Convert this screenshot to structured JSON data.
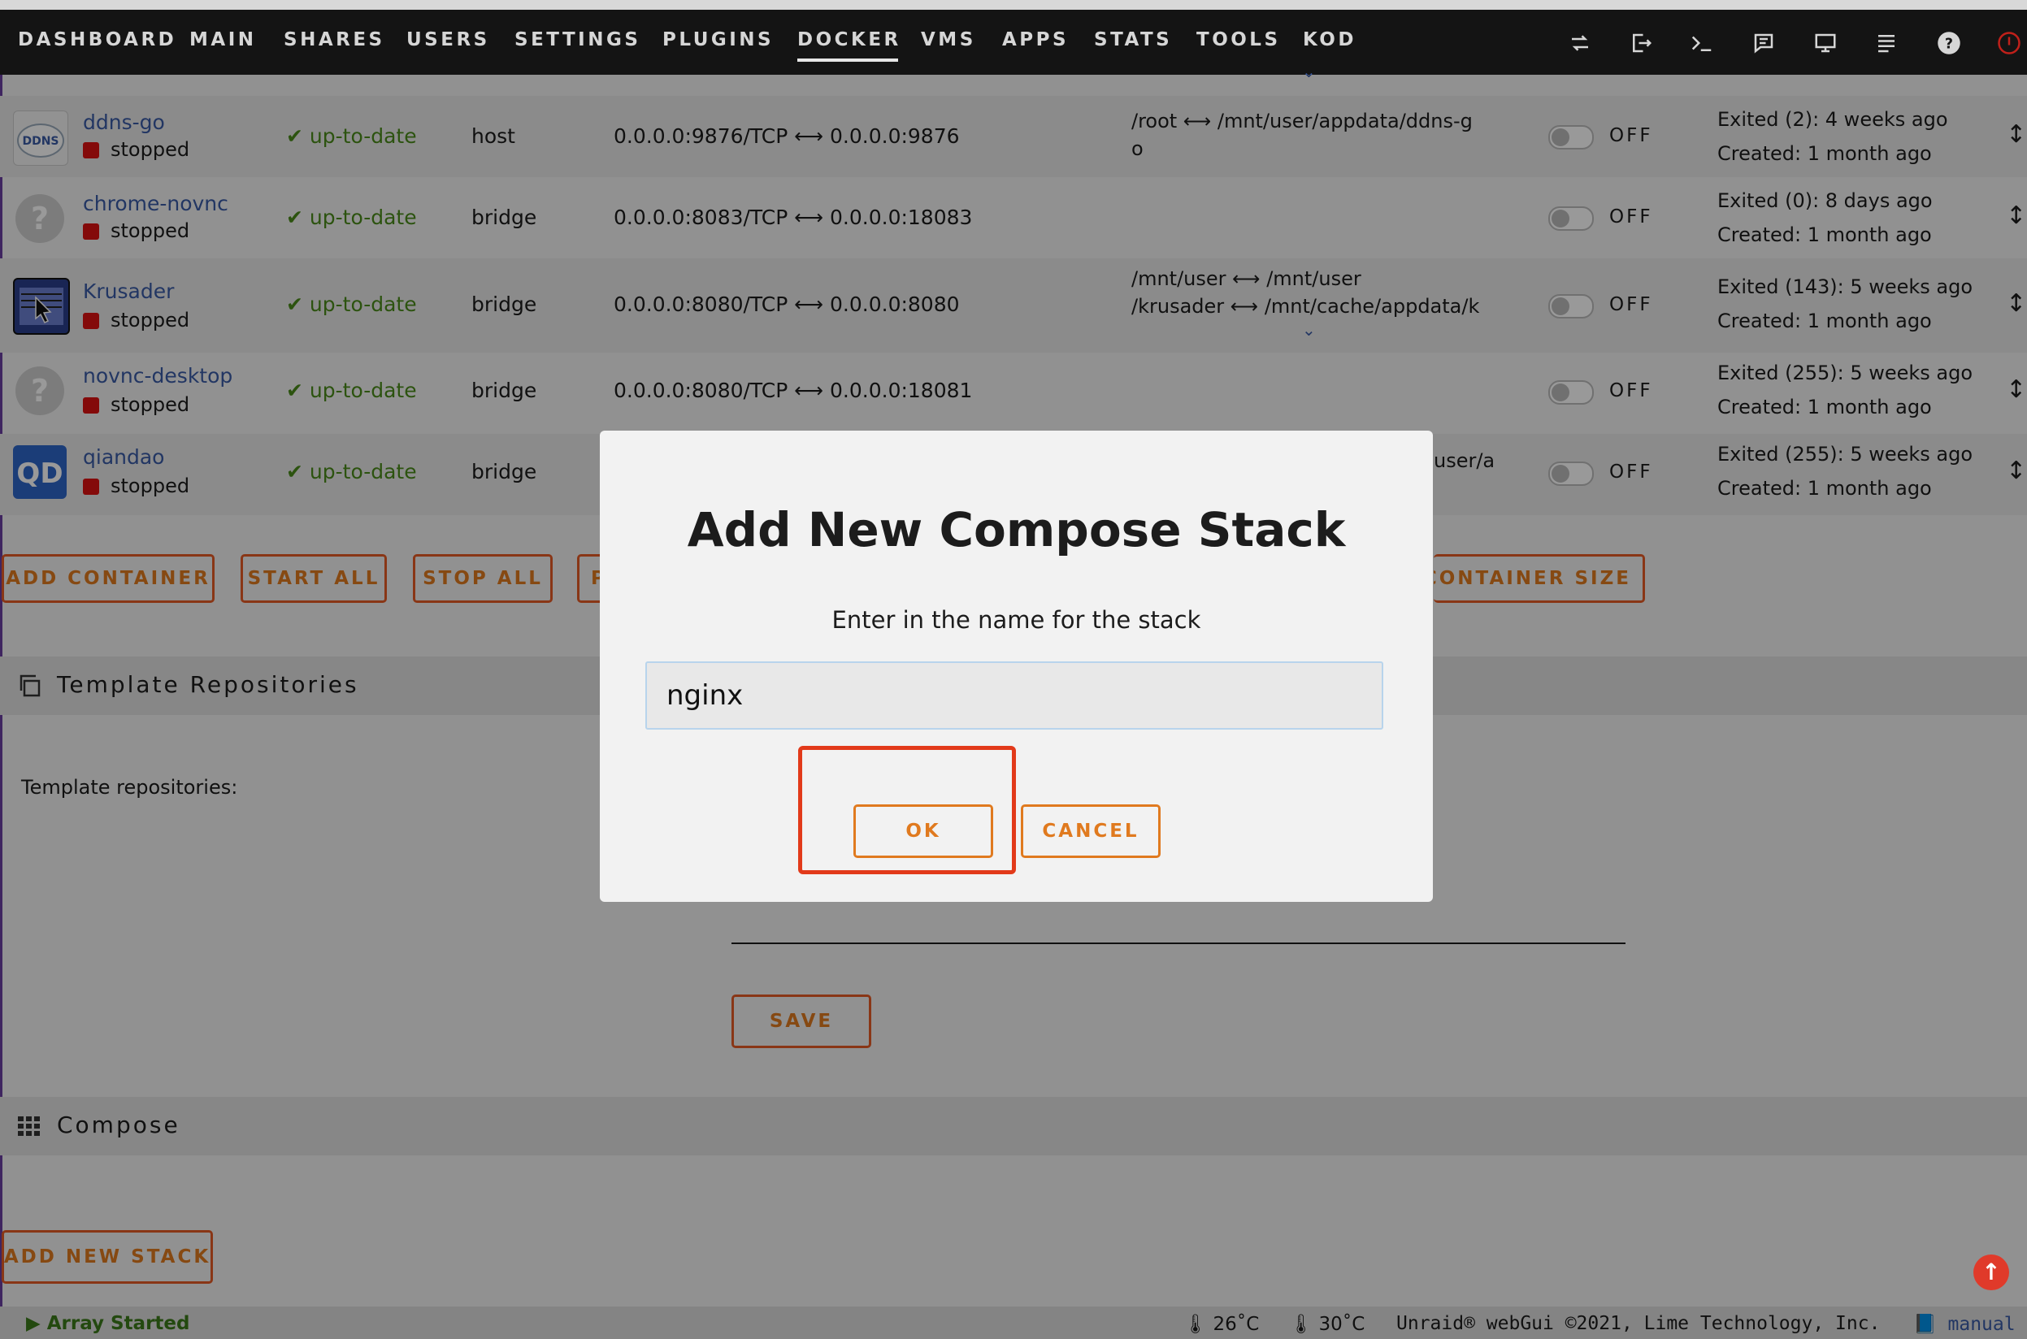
{
  "nav": {
    "items": [
      "DASHBOARD",
      "MAIN",
      "SHARES",
      "USERS",
      "SETTINGS",
      "PLUGINS",
      "DOCKER",
      "VMS",
      "APPS",
      "STATS",
      "TOOLS",
      "KOD"
    ],
    "active": "DOCKER",
    "icons": [
      "refresh-icon",
      "logout-icon",
      "terminal-icon",
      "feedback-icon",
      "monitor-icon",
      "log-icon",
      "help-icon",
      "alert-icon"
    ]
  },
  "containers": [
    {
      "icon_text": "DDNS",
      "name": "ddns-go",
      "state": "stopped",
      "update": "up-to-date",
      "network": "host",
      "port_from": "0.0.0.0:9876/TCP",
      "port_to": "0.0.0.0:9876",
      "volumes": [
        [
          "/root",
          "/mnt/user/appdata/ddns-g"
        ],
        [
          "o",
          ""
        ]
      ],
      "autostart": "OFF",
      "status1": "Exited (2): 4 weeks ago",
      "status2": "Created: 1 month ago"
    },
    {
      "icon_text": "?",
      "name": "chrome-novnc",
      "state": "stopped",
      "update": "up-to-date",
      "network": "bridge",
      "port_from": "0.0.0.0:8083/TCP",
      "port_to": "0.0.0.0:18083",
      "volumes": [],
      "autostart": "OFF",
      "status1": "Exited (0): 8 days ago",
      "status2": "Created: 1 month ago"
    },
    {
      "icon_text": "",
      "name": "Krusader",
      "state": "stopped",
      "update": "up-to-date",
      "network": "bridge",
      "port_from": "0.0.0.0:8080/TCP",
      "port_to": "0.0.0.0:8080",
      "volumes": [
        [
          "/mnt/user",
          "/mnt/user"
        ],
        [
          "/krusader",
          "/mnt/cache/appdata/k"
        ]
      ],
      "autostart": "OFF",
      "status1": "Exited (143): 5 weeks ago",
      "status2": "Created: 1 month ago"
    },
    {
      "icon_text": "?",
      "name": "novnc-desktop",
      "state": "stopped",
      "update": "up-to-date",
      "network": "bridge",
      "port_from": "0.0.0.0:8080/TCP",
      "port_to": "0.0.0.0:18081",
      "volumes": [],
      "autostart": "OFF",
      "status1": "Exited (255): 5 weeks ago",
      "status2": "Created: 1 month ago"
    },
    {
      "icon_text": "QD",
      "name": "qiandao",
      "state": "stopped",
      "update": "up-to-date",
      "network": "bridge",
      "port_from": "",
      "port_to": "",
      "volume_fragment": "user/a",
      "autostart": "OFF",
      "status1": "Exited (255): 5 weeks ago",
      "status2": "Created: 1 month ago"
    }
  ],
  "actions": {
    "add_container": "ADD CONTAINER",
    "start_all": "START ALL",
    "stop_all": "STOP ALL",
    "partial": "P",
    "container_size": "CONTAINER SIZE"
  },
  "template_section": {
    "title": "Template Repositories",
    "label": "Template repositories:",
    "save": "SAVE"
  },
  "compose_section": {
    "title": "Compose",
    "add_stack": "ADD NEW STACK"
  },
  "modal": {
    "title": "Add New Compose Stack",
    "message": "Enter in the name for the stack",
    "input_value": "nginx",
    "ok": "OK",
    "cancel": "CANCEL"
  },
  "footer": {
    "array_status": "Array Started",
    "temp1": "26˚C",
    "temp2": "30˚C",
    "copyright": "Unraid® webGui ©2021, Lime Technology, Inc.",
    "manual": "manual"
  }
}
